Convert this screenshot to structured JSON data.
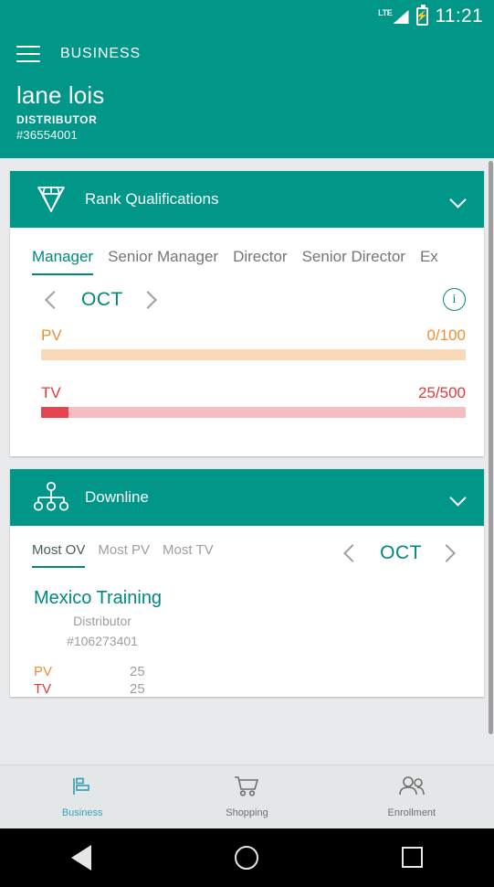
{
  "status_bar": {
    "network_label": "LTE",
    "time": "11:21",
    "battery_icon": "battery-charging-icon",
    "signal_icon": "signal-bars-icon"
  },
  "app_bar": {
    "menu_icon": "hamburger-menu-icon",
    "title": "BUSINESS"
  },
  "profile": {
    "name": "lane lois",
    "role": "DISTRIBUTOR",
    "id": "#36554001"
  },
  "rank_card": {
    "icon": "diamond-icon",
    "title": "Rank Qualifications",
    "collapse_icon": "chevron-down-icon",
    "tabs": [
      {
        "label": "Manager",
        "active": true
      },
      {
        "label": "Senior Manager",
        "active": false
      },
      {
        "label": "Director",
        "active": false
      },
      {
        "label": "Senior Director",
        "active": false
      },
      {
        "label": "Ex",
        "active": false
      }
    ],
    "month_nav": {
      "prev_icon": "chevron-left-icon",
      "month": "OCT",
      "next_icon": "chevron-right-icon",
      "info_icon": "info-circle-icon"
    },
    "metrics": [
      {
        "label": "PV",
        "value": "0/100",
        "current": 0,
        "target": 100,
        "percent": 0,
        "color": "#ef8f31",
        "track": "#fad9b8"
      },
      {
        "label": "TV",
        "value": "25/500",
        "current": 25,
        "target": 500,
        "percent": 6.4,
        "color": "#e74452",
        "track": "#f7bec2"
      }
    ]
  },
  "downline_card": {
    "icon": "org-chart-icon",
    "title": "Downline",
    "collapse_icon": "chevron-down-icon",
    "tabs": [
      {
        "label": "Most OV",
        "active": true
      },
      {
        "label": "Most PV",
        "active": false
      },
      {
        "label": "Most TV",
        "active": false
      }
    ],
    "month_nav": {
      "prev_icon": "chevron-left-icon",
      "month": "OCT",
      "next_icon": "chevron-right-icon"
    },
    "entries": [
      {
        "name": "Mexico Training",
        "role": "Distributor",
        "id": "#106273401",
        "stats": [
          {
            "label": "PV",
            "value": "25"
          },
          {
            "label": "TV",
            "value": "25"
          }
        ]
      }
    ]
  },
  "bottom_nav": [
    {
      "label": "Business",
      "icon": "bar-chart-icon",
      "active": true
    },
    {
      "label": "Shopping",
      "icon": "shopping-cart-icon",
      "active": false
    },
    {
      "label": "Enrollment",
      "icon": "people-icon",
      "active": false
    }
  ],
  "system_nav": {
    "back_icon": "triangle-back-icon",
    "home_icon": "circle-home-icon",
    "recents_icon": "square-recents-icon"
  },
  "theme": {
    "primary": "#009688",
    "accent": "#00897b",
    "pv_color": "#ef8f31",
    "tv_color": "#e03b3b",
    "nav_active": "#3d9fb4"
  }
}
